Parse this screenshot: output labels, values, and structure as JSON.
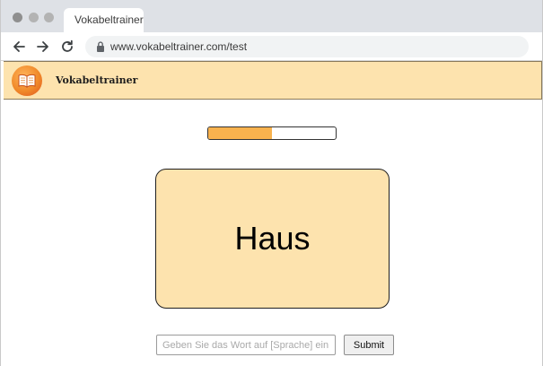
{
  "browser": {
    "tab_title": "Vokabeltrainer",
    "url": "www.vokabeltrainer.com/test",
    "nav_icons": [
      "back-arrow-icon",
      "forward-arrow-icon",
      "reload-icon",
      "lock-icon"
    ]
  },
  "app": {
    "title": "Vokabeltrainer",
    "logo_icon": "book-icon"
  },
  "progress": {
    "fraction": 0.5
  },
  "card": {
    "word": "Haus"
  },
  "answer": {
    "placeholder": "Geben Sie das Wort auf [Sprache] ein.",
    "value": "",
    "submit_label": "Submit"
  },
  "colors": {
    "header_bg": "#fde3ae",
    "card_bg": "#fde3ae",
    "progress_fill": "#f8b24e",
    "tab_strip": "#dee1e6"
  }
}
